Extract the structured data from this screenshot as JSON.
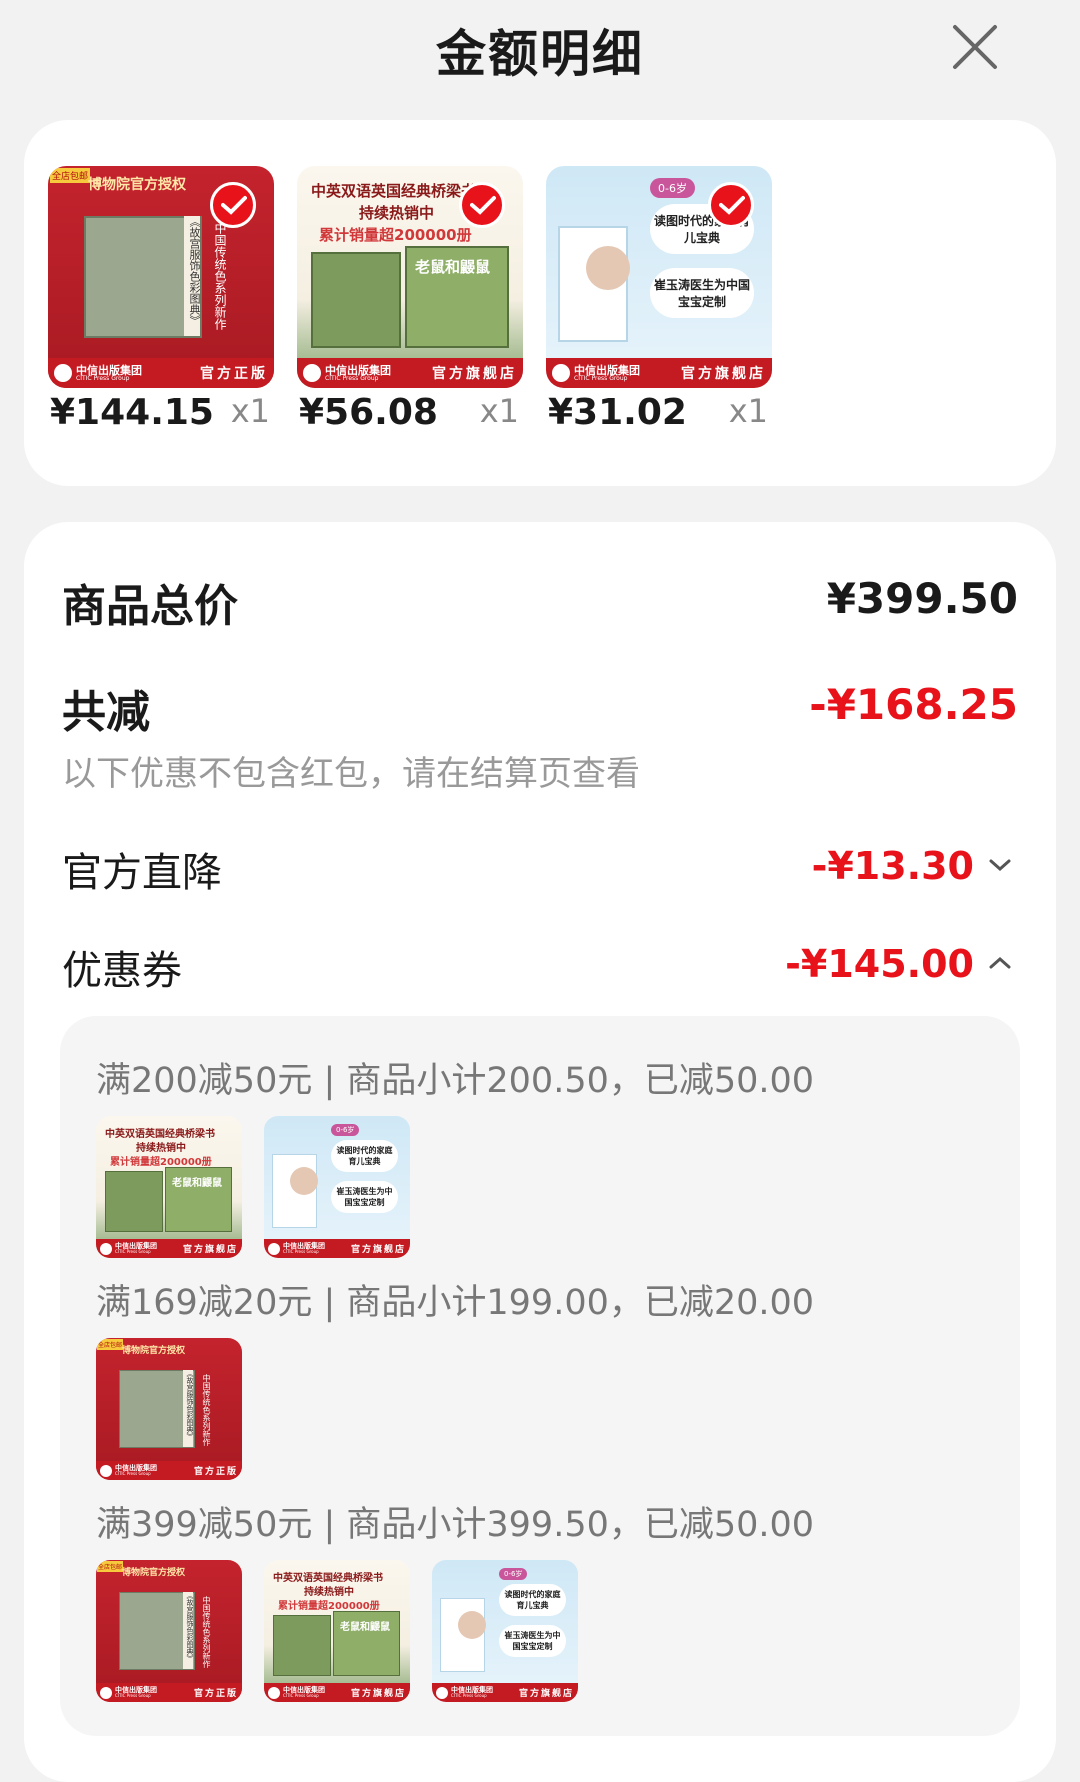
{
  "header": {
    "title": "金额明细"
  },
  "products": [
    {
      "price": "¥144.15",
      "qty": "x1",
      "cover": "a",
      "top_text": "博物院官方授权",
      "badge": "官方正版",
      "publisher": "中信出版集团",
      "publisher_en": "CITIC Press Group",
      "vertical_text": "中国传统色系列新作",
      "book_title": "《故宫服饰色彩图典》",
      "tag": "全店包邮"
    },
    {
      "price": "¥56.08",
      "qty": "x1",
      "cover": "b",
      "top_text": "中英双语英国经典桥梁书",
      "sub_text": "持续热销中",
      "highlight": "累计销量超200000册",
      "book_title": "老鼠和鼹鼠",
      "badge": "官方旗舰店",
      "publisher": "中信出版集团",
      "publisher_en": "CITIC Press Group"
    },
    {
      "price": "¥31.02",
      "qty": "x1",
      "cover": "c",
      "age": "0-6岁",
      "bubble1": "读图时代的家庭育儿宝典",
      "bubble2": "崔玉涛医生为中国宝宝定制",
      "badge": "官方旗舰店",
      "publisher": "中信出版集团",
      "publisher_en": "CITIC Press Group"
    }
  ],
  "summary": {
    "total_label": "商品总价",
    "total_value": "¥399.50",
    "reduce_label": "共减",
    "reduce_value": "-¥168.25",
    "reduce_note": "以下优惠不包含红包，请在结算页查看",
    "direct_label": "官方直降",
    "direct_value": "-¥13.30",
    "coupon_label": "优惠券",
    "coupon_value": "-¥145.00"
  },
  "coupons": [
    {
      "text": "满200减50元 | 商品小计200.50，已减50.00",
      "items": [
        "b",
        "c"
      ]
    },
    {
      "text": "满169减20元 | 商品小计199.00，已减20.00",
      "items": [
        "a"
      ]
    },
    {
      "text": "满399减50元 | 商品小计399.50，已减50.00",
      "items": [
        "a",
        "b",
        "c"
      ]
    }
  ],
  "colors": {
    "accent": "#e8121b",
    "bg": "#f2f2f2"
  }
}
